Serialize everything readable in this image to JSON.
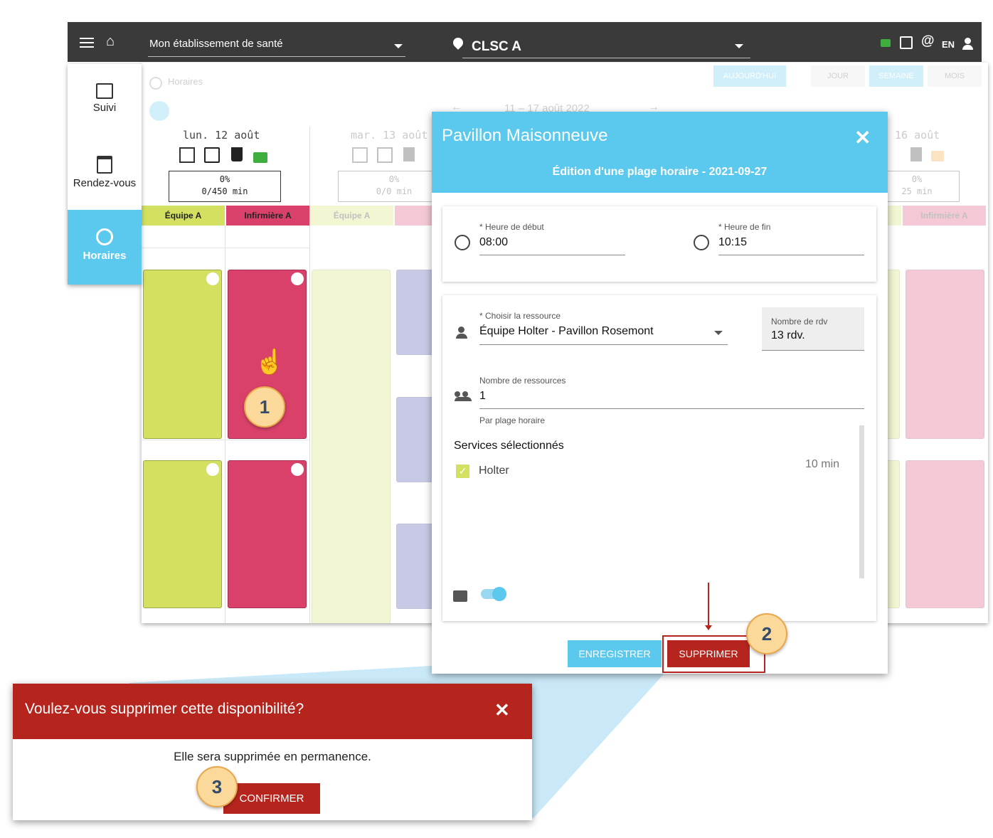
{
  "topbar": {
    "establishment": "Mon établissement de santé",
    "location": "CLSC A",
    "lang": "EN"
  },
  "sidebar": {
    "items": [
      {
        "label": "Suivi",
        "icon": "list-icon"
      },
      {
        "label": "Rendez-vous",
        "icon": "calendar-icon"
      },
      {
        "label": "Horaires",
        "icon": "clock-icon",
        "active": true
      }
    ]
  },
  "schedule": {
    "section_title": "Horaires",
    "buttons": {
      "today": "AUJOURD'HUI",
      "day": "JOUR",
      "week": "SEMAINE",
      "month": "MOIS"
    },
    "range": "11 – 17 août 2022",
    "days": [
      {
        "label": "lun. 12 août",
        "pct": "0%",
        "mins": "0/450 min"
      },
      {
        "label": "mar. 13 août",
        "pct": "0%",
        "mins": "0/0 min"
      },
      {
        "label": "16 août",
        "pct": "0%",
        "mins": "25 min"
      }
    ],
    "teams": {
      "team": "Équipe A",
      "nurse": "Infirmière A"
    }
  },
  "colors": {
    "team": "#d4e05f",
    "nurse": "#d9416a",
    "accent": "#5bc8ee",
    "danger": "#b5251d",
    "lock_green": "#3fae3f"
  },
  "modal": {
    "title": "Pavillon Maisonneuve",
    "subtitle": "Édition d'une plage horaire - 2021-09-27",
    "start_label": "* Heure de début",
    "start_value": "08:00",
    "end_label": "* Heure de fin",
    "end_value": "10:15",
    "resource_label": "* Choisir la ressource",
    "resource_value": "Équipe Holter - Pavillon Rosemont",
    "appointments_label": "Nombre de rdv",
    "appointments_value": "13 rdv.",
    "resources_count_label": "Nombre de ressources",
    "resources_count_value": "1",
    "resources_hint": "Par plage horaire",
    "services_title": "Services sélectionnés",
    "service": {
      "name": "Holter",
      "duration": "10 min",
      "checked": true
    },
    "save_label": "ENREGISTRER",
    "delete_label": "SUPPRIMER"
  },
  "confirm_dialog": {
    "title": "Voulez-vous supprimer cette disponibilité?",
    "message": "Elle sera supprimée en permanence.",
    "confirm_label": "CONFIRMER"
  },
  "steps": [
    "1",
    "2",
    "3"
  ]
}
